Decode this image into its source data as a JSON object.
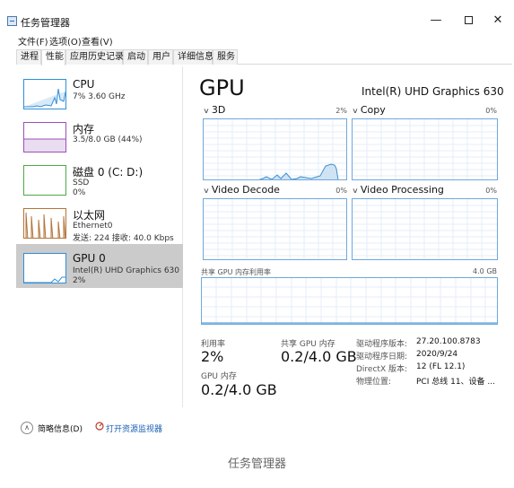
{
  "window": {
    "title": "任务管理器",
    "controls": {
      "minimize": "—",
      "close": "✕"
    }
  },
  "menu": [
    "文件(F)",
    "选项(O)",
    "查看(V)"
  ],
  "tabs": [
    {
      "label": "进程",
      "active": false
    },
    {
      "label": "性能",
      "active": true
    },
    {
      "label": "应用历史记录",
      "active": false
    },
    {
      "label": "启动",
      "active": false
    },
    {
      "label": "用户",
      "active": false
    },
    {
      "label": "详细信息",
      "active": false
    },
    {
      "label": "服务",
      "active": false
    }
  ],
  "sidebar": {
    "items": [
      {
        "name": "CPU",
        "line1": "7% 3.60 GHz",
        "line2": "",
        "line3": "",
        "color": "#2f8fd8"
      },
      {
        "name": "内存",
        "line1": "3.5/8.0 GB (44%)",
        "line2": "",
        "line3": "",
        "color": "#9b4fb8"
      },
      {
        "name": "磁盘 0 (C: D:)",
        "line1": "SSD",
        "line2": "0%",
        "line3": "",
        "color": "#4da845"
      },
      {
        "name": "以太网",
        "line1": "Ethernet0",
        "line2": "发送: 224 接收: 40.0 Kbps",
        "line3": "",
        "color": "#b3743b"
      },
      {
        "name": "GPU 0",
        "line1": "Intel(R) UHD Graphics 630",
        "line2": "2%",
        "line3": "",
        "color": "#2f8fd8",
        "selected": true
      }
    ]
  },
  "main": {
    "title": "GPU",
    "model": "Intel(R) UHD Graphics 630",
    "graphs": [
      {
        "name": "3D",
        "percent": "2%"
      },
      {
        "name": "Copy",
        "percent": "0%"
      },
      {
        "name": "Video Decode",
        "percent": "0%"
      },
      {
        "name": "Video Processing",
        "percent": "0%"
      }
    ],
    "shared_memory": {
      "label": "共享 GPU 内存利用率",
      "max": "4.0 GB"
    },
    "stats": {
      "utilization_label": "利用率",
      "utilization_value": "2%",
      "shared_mem_label": "共享 GPU 内存",
      "shared_mem_value": "0.2/4.0 GB",
      "gpu_mem_label": "GPU 内存",
      "gpu_mem_value": "0.2/4.0 GB"
    },
    "properties": [
      {
        "label": "驱动程序版本:",
        "value": "27.20.100.8783"
      },
      {
        "label": "驱动程序日期:",
        "value": "2020/9/24"
      },
      {
        "label": "DirectX 版本:",
        "value": "12 (FL 12.1)"
      },
      {
        "label": "物理位置:",
        "value": "PCI 总线 11、设备 ..."
      }
    ]
  },
  "footer": {
    "brief_label": "简略信息(D)",
    "monitor_link": "打开资源监视器"
  },
  "caption": "任务管理器"
}
